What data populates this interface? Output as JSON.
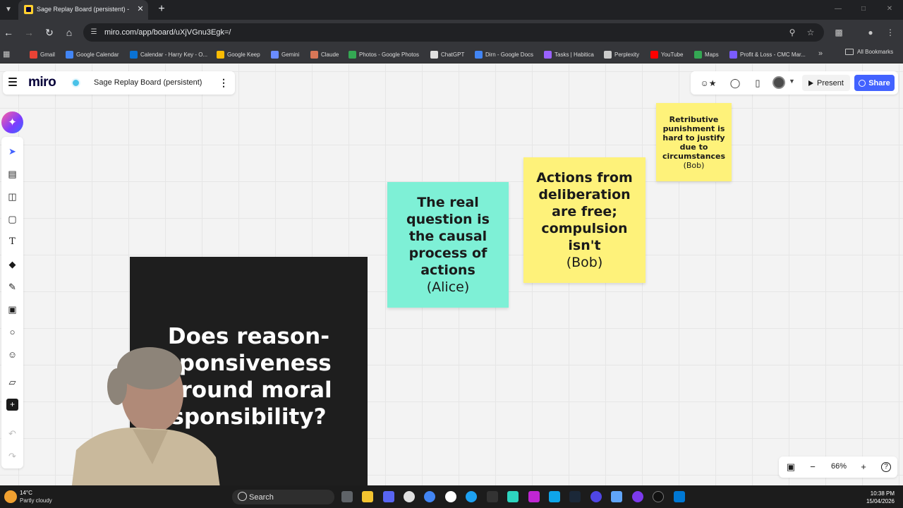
{
  "browser": {
    "tab_title": "Sage Replay Board (persistent) - Miro",
    "url": "miro.com/app/board/uXjVGnu3Egk=/",
    "bookmarks": [
      {
        "label": "Gmail",
        "color": "#ea4335"
      },
      {
        "label": "Google Calendar",
        "color": "#4285f4"
      },
      {
        "label": "Calendar - Harry Key - O...",
        "color": "#0a72d4"
      },
      {
        "label": "Google Keep",
        "color": "#fbbc04"
      },
      {
        "label": "Gemini",
        "color": "#6a8cff"
      },
      {
        "label": "Claude",
        "color": "#d97757"
      },
      {
        "label": "Photos - Google Photos",
        "color": "#34a853"
      },
      {
        "label": "ChatGPT",
        "color": "#e0e0e0"
      },
      {
        "label": "Dirn - Google Docs",
        "color": "#4285f4"
      },
      {
        "label": "Tasks | Habitica",
        "color": "#9a62ff"
      },
      {
        "label": "Perplexity",
        "color": "#cccccc"
      },
      {
        "label": "YouTube",
        "color": "#ff0000"
      },
      {
        "label": "Maps",
        "color": "#34a853"
      },
      {
        "label": "Profit & Loss - CMC Mar...",
        "color": "#7a5cff"
      }
    ],
    "all_bookmarks": "All Bookmarks"
  },
  "miro": {
    "logo": "miro",
    "board_title": "Sage Replay Board (persistent)",
    "present_label": "Present",
    "share_label": "Share",
    "zoom_level": "66%"
  },
  "board": {
    "stickies": {
      "alice": {
        "lines": [
          "The real",
          "question is",
          "the causal",
          "process of",
          "actions"
        ],
        "author": "(Alice)"
      },
      "bob1": {
        "lines": [
          "Actions from",
          "deliberation",
          "are free;",
          "compulsion",
          "isn't"
        ],
        "author": "(Bob)"
      },
      "bob2": {
        "lines": [
          "Retributive",
          "punishment is",
          "hard to justify",
          "due to",
          "circumstances"
        ],
        "author": "(Bob)"
      }
    },
    "slide": {
      "lines": [
        "Does reason-",
        "sponsiveness",
        "ground moral",
        "sponsibility?"
      ]
    }
  },
  "taskbar": {
    "weather_temp": "14°C",
    "weather_desc": "Partly cloudy",
    "search_label": "Search",
    "time": "10:38 PM",
    "date": "15/04/2026"
  },
  "colors": {
    "miro_blue": "#4262ff",
    "sticky_cyan": "#7ef0d6",
    "sticky_yellow": "#fef27a"
  }
}
